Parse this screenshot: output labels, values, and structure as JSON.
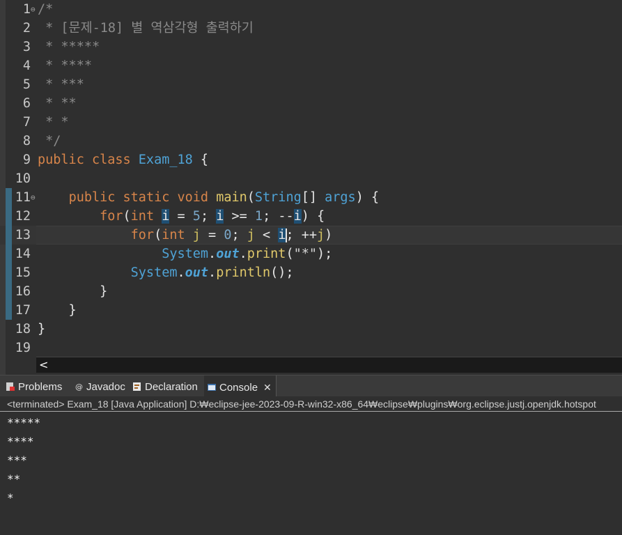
{
  "editor": {
    "file_class": "Exam_18",
    "lines": [
      {
        "n": "1",
        "code": [
          {
            "c": "cm",
            "t": "/*"
          }
        ]
      },
      {
        "n": "2",
        "code": [
          {
            "c": "cm",
            "t": " * [문제-18] 별 역삼각형 출력하기"
          }
        ]
      },
      {
        "n": "3",
        "code": [
          {
            "c": "cm",
            "t": " * *****"
          }
        ]
      },
      {
        "n": "4",
        "code": [
          {
            "c": "cm",
            "t": " * ****"
          }
        ]
      },
      {
        "n": "5",
        "code": [
          {
            "c": "cm",
            "t": " * ***"
          }
        ]
      },
      {
        "n": "6",
        "code": [
          {
            "c": "cm",
            "t": " * **"
          }
        ]
      },
      {
        "n": "7",
        "code": [
          {
            "c": "cm",
            "t": " * *"
          }
        ]
      },
      {
        "n": "8",
        "code": [
          {
            "c": "cm",
            "t": " */"
          }
        ]
      },
      {
        "n": "9",
        "code": [
          {
            "c": "kw",
            "t": "public class "
          },
          {
            "c": "ty",
            "t": "Exam_18"
          },
          {
            "c": "plain",
            "t": " {"
          }
        ]
      },
      {
        "n": "10",
        "code": []
      },
      {
        "n": "11",
        "code": [
          {
            "c": "plain",
            "t": "    "
          },
          {
            "c": "kw",
            "t": "public static void "
          },
          {
            "c": "fn",
            "t": "main"
          },
          {
            "c": "plain",
            "t": "("
          },
          {
            "c": "ty",
            "t": "String"
          },
          {
            "c": "plain",
            "t": "[] "
          },
          {
            "c": "ty",
            "t": "args"
          },
          {
            "c": "plain",
            "t": ") {"
          }
        ]
      },
      {
        "n": "12",
        "code": [
          {
            "c": "plain",
            "t": "        "
          },
          {
            "c": "kw",
            "t": "for"
          },
          {
            "c": "plain",
            "t": "("
          },
          {
            "c": "kw",
            "t": "int "
          },
          {
            "c": "hl var",
            "t": "i"
          },
          {
            "c": "plain",
            "t": " = "
          },
          {
            "c": "num",
            "t": "5"
          },
          {
            "c": "plain",
            "t": "; "
          },
          {
            "c": "hl var",
            "t": "i"
          },
          {
            "c": "plain",
            "t": " >= "
          },
          {
            "c": "num",
            "t": "1"
          },
          {
            "c": "plain",
            "t": "; --"
          },
          {
            "c": "hl var",
            "t": "i"
          },
          {
            "c": "plain",
            "t": ") {"
          }
        ]
      },
      {
        "n": "13",
        "code": [
          {
            "c": "plain",
            "t": "            "
          },
          {
            "c": "kw",
            "t": "for"
          },
          {
            "c": "plain",
            "t": "("
          },
          {
            "c": "kw",
            "t": "int "
          },
          {
            "c": "var",
            "t": "j"
          },
          {
            "c": "plain",
            "t": " = "
          },
          {
            "c": "num",
            "t": "0"
          },
          {
            "c": "plain",
            "t": "; "
          },
          {
            "c": "var",
            "t": "j"
          },
          {
            "c": "plain",
            "t": " < "
          },
          {
            "c": "hl var",
            "t": "i"
          },
          {
            "c": "cursor",
            "t": ""
          },
          {
            "c": "plain",
            "t": "; ++"
          },
          {
            "c": "var",
            "t": "j"
          },
          {
            "c": "plain",
            "t": ")"
          }
        ]
      },
      {
        "n": "14",
        "code": [
          {
            "c": "plain",
            "t": "                "
          },
          {
            "c": "ty",
            "t": "System"
          },
          {
            "c": "plain",
            "t": "."
          },
          {
            "c": "fld",
            "t": "out"
          },
          {
            "c": "plain",
            "t": "."
          },
          {
            "c": "fn",
            "t": "print"
          },
          {
            "c": "plain",
            "t": "("
          },
          {
            "c": "str",
            "t": "\"*\""
          },
          {
            "c": "plain",
            "t": ");"
          }
        ]
      },
      {
        "n": "15",
        "code": [
          {
            "c": "plain",
            "t": "            "
          },
          {
            "c": "ty",
            "t": "System"
          },
          {
            "c": "plain",
            "t": "."
          },
          {
            "c": "fld",
            "t": "out"
          },
          {
            "c": "plain",
            "t": "."
          },
          {
            "c": "fn",
            "t": "println"
          },
          {
            "c": "plain",
            "t": "();"
          }
        ]
      },
      {
        "n": "16",
        "code": [
          {
            "c": "plain",
            "t": "        }"
          }
        ]
      },
      {
        "n": "17",
        "code": [
          {
            "c": "plain",
            "t": "    }"
          }
        ]
      },
      {
        "n": "18",
        "code": [
          {
            "c": "plain",
            "t": "}"
          }
        ]
      },
      {
        "n": "19",
        "code": []
      }
    ],
    "scroll_left_glyph": "<"
  },
  "panel": {
    "tabs": [
      {
        "label": "Problems",
        "icon": "problems-icon"
      },
      {
        "label": "Javadoc",
        "icon": "javadoc-icon"
      },
      {
        "label": "Declaration",
        "icon": "declaration-icon"
      },
      {
        "label": "Console",
        "icon": "console-icon",
        "close": "✕"
      }
    ],
    "status": "<terminated> Exam_18 [Java Application] D:₩eclipse-jee-2023-09-R-win32-x86_64₩eclipse₩plugins₩org.eclipse.justj.openjdk.hotspot",
    "output": [
      "*****",
      "****",
      "***",
      "**",
      "*"
    ]
  },
  "colors": {
    "accent": "#3a6a82",
    "highlight": "#1f4f73",
    "keyword": "#d8854a",
    "type": "#4fa3d6"
  }
}
